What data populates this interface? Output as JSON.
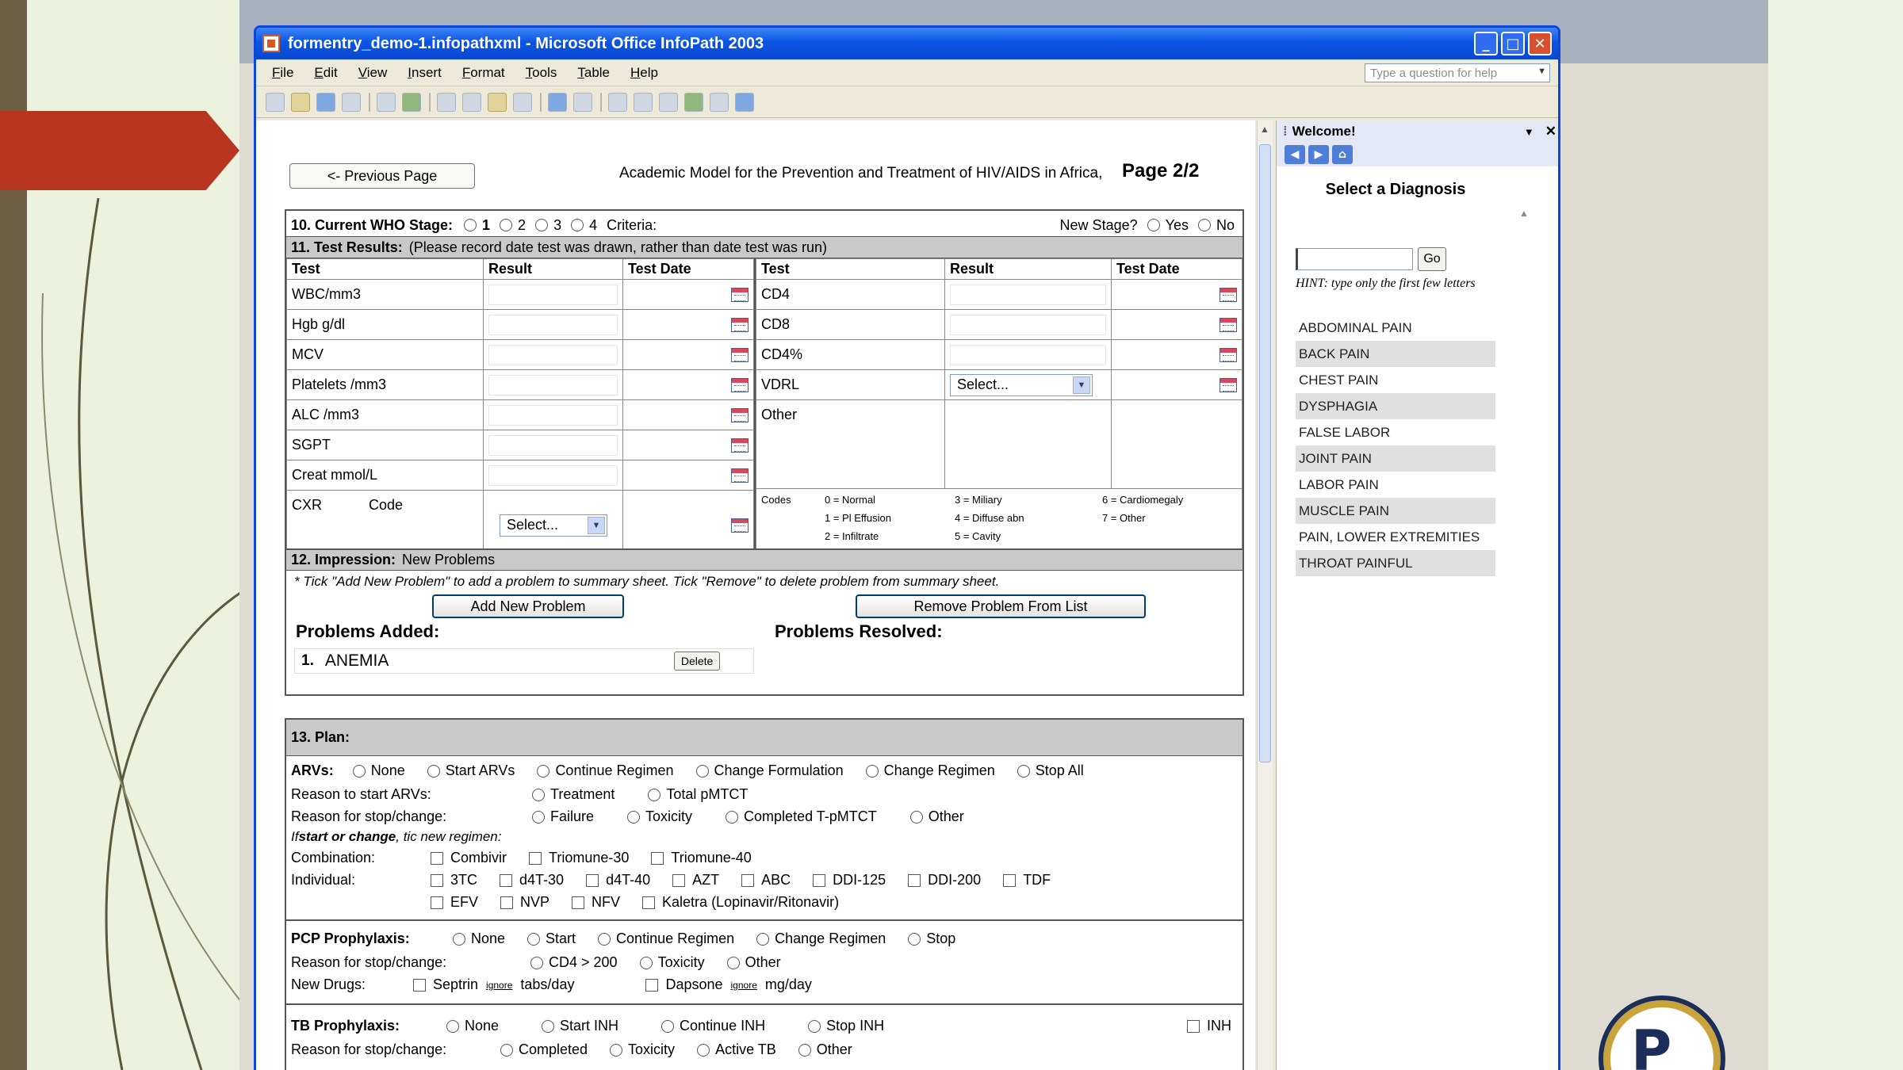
{
  "window": {
    "title": "formentry_demo-1.infopathxml - Microsoft Office InfoPath 2003",
    "controls": {
      "minimize": "_",
      "maximize": "□",
      "close": "✕"
    }
  },
  "menu": [
    "File",
    "Edit",
    "View",
    "Insert",
    "Format",
    "Tools",
    "Table",
    "Help"
  ],
  "help_placeholder": "Type a question for help",
  "toolbar_icons": [
    "new-icon",
    "open-icon",
    "save-icon",
    "print-icon",
    "print-preview-icon",
    "spelling-icon",
    "cut-icon",
    "copy-icon",
    "paste-icon",
    "format-painter-icon",
    "undo-icon",
    "redo-icon",
    "insert-table-icon",
    "insert-layout-icon",
    "design-tasks-icon",
    "export-icon",
    "help-icon"
  ],
  "form": {
    "prev_page": "<- Previous Page",
    "program": "Academic Model for the Prevention and Treatment of HIV/AIDS in Africa,",
    "page": "Page 2/2",
    "who": {
      "label": "10.  Current WHO Stage:",
      "stages": [
        "1",
        "2",
        "3",
        "4"
      ],
      "criteria": "Criteria:",
      "new_stage": "New Stage?",
      "yes": "Yes",
      "no": "No"
    },
    "tests": {
      "heading": "11.  Test Results:",
      "note": "(Please record date test was drawn, rather than date test was run)",
      "columns": [
        "Test",
        "Result",
        "Test Date"
      ],
      "left": [
        "WBC/mm3",
        "Hgb g/dl",
        "MCV",
        "Platelets /mm3",
        "ALC /mm3",
        "SGPT",
        "Creat mmol/L"
      ],
      "right": [
        "CD4",
        "CD8",
        "CD4%",
        "VDRL",
        "Other"
      ],
      "vdrl_select": "Select...",
      "cxr": "CXR",
      "code": "Code",
      "cxr_select": "Select...",
      "codes_label": "Codes",
      "codes_col1": [
        "0 = Normal",
        "1 = Pl Effusion",
        "2 = Infiltrate"
      ],
      "codes_col2": [
        "3 = Miliary",
        "4 = Diffuse abn",
        "5 = Cavity"
      ],
      "codes_col3": [
        "6 = Cardiomegaly",
        "7 = Other"
      ]
    },
    "impression": {
      "heading": "12.  Impression:",
      "sub": "New Problems",
      "instruction": "* Tick \"Add New Problem\" to add a problem to summary sheet.  Tick \"Remove\" to delete problem from summary sheet.",
      "add_btn": "Add New Problem",
      "remove_btn": "Remove Problem From List",
      "added_label": "Problems Added:",
      "resolved_label": "Problems Resolved:",
      "problem_num": "1.",
      "problem": "ANEMIA",
      "delete": "Delete"
    },
    "plan": {
      "heading": "13. Plan:",
      "arvs_label": "ARVs:",
      "arvs": [
        "None",
        "Start ARVs",
        "Continue Regimen",
        "Change Formulation",
        "Change Regimen",
        "Stop All"
      ],
      "reason_start_label": "Reason to start ARVs:",
      "reason_start": [
        "Treatment",
        "Total pMTCT"
      ],
      "reason_stop_label": "Reason for stop/change:",
      "reason_stop": [
        "Failure",
        "Toxicity",
        "Completed T-pMTCT",
        "Other"
      ],
      "if_start_prefix": "If ",
      "if_start_bold": "start or change",
      "if_start_suffix": ", tic new regimen:",
      "combo_label": "Combination:",
      "combo": [
        "Combivir",
        "Triomune-30",
        "Triomune-40"
      ],
      "indiv_label": "Individual:",
      "indiv1": [
        "3TC",
        "d4T-30",
        "d4T-40",
        "AZT",
        "ABC",
        "DDI-125",
        "DDI-200",
        "TDF"
      ],
      "indiv2": [
        "EFV",
        "NVP",
        "NFV",
        "Kaletra (Lopinavir/Ritonavir)"
      ],
      "pcp_label": "PCP Prophylaxis:",
      "pcp": [
        "None",
        "Start",
        "Continue Regimen",
        "Change Regimen",
        "Stop"
      ],
      "pcp_reason_label": "Reason for stop/change:",
      "pcp_reason": [
        "CD4 > 200",
        "Toxicity",
        "Other"
      ],
      "newdrugs_label": "New Drugs:",
      "septrin": "Septrin",
      "ignore": "ignore",
      "tabs_day": "tabs/day",
      "dapsone": "Dapsone",
      "mg_day": "mg/day",
      "tb_label": "TB Prophylaxis:",
      "tb": [
        "None",
        "Start INH",
        "Continue INH",
        "Stop INH"
      ],
      "inh": "INH",
      "tb_reason_label": "Reason for stop/change:",
      "tb_reason": [
        "Completed",
        "Toxicity",
        "Active TB",
        "Other"
      ]
    }
  },
  "taskpane": {
    "title": "Welcome!",
    "heading": "Select a Diagnosis",
    "go": "Go",
    "hint": "HINT: type only the first few letters",
    "diagnoses": [
      "ABDOMINAL PAIN",
      "BACK PAIN",
      "CHEST PAIN",
      "DYSPHAGIA",
      "FALSE LABOR",
      "JOINT PAIN",
      "LABOR PAIN",
      "MUSCLE PAIN",
      "PAIN, LOWER EXTREMITIES",
      "THROAT PAINFUL"
    ]
  },
  "logo_text": "P"
}
